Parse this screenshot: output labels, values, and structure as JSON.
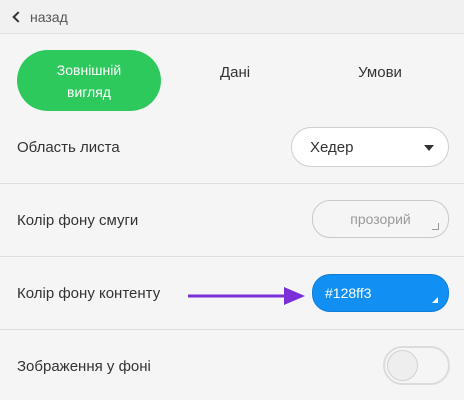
{
  "back": {
    "label": "назад"
  },
  "tabs": [
    {
      "label": "Зовнішній вигляд",
      "active": true
    },
    {
      "label": "Дані",
      "active": false
    },
    {
      "label": "Умови",
      "active": false
    }
  ],
  "settings": {
    "sheet_area": {
      "label": "Область листа",
      "value": "Хедер"
    },
    "stripe_bg": {
      "label": "Колір фону смуги",
      "placeholder": "прозорий"
    },
    "content_bg": {
      "label": "Колір фону контенту",
      "value": "#128ff3"
    },
    "bg_image": {
      "label": "Зображення у фоні",
      "enabled": false
    }
  },
  "colors": {
    "accent_green": "#2ec95c",
    "content_color": "#128ff3",
    "annotation_arrow": "#7b2fd6"
  }
}
